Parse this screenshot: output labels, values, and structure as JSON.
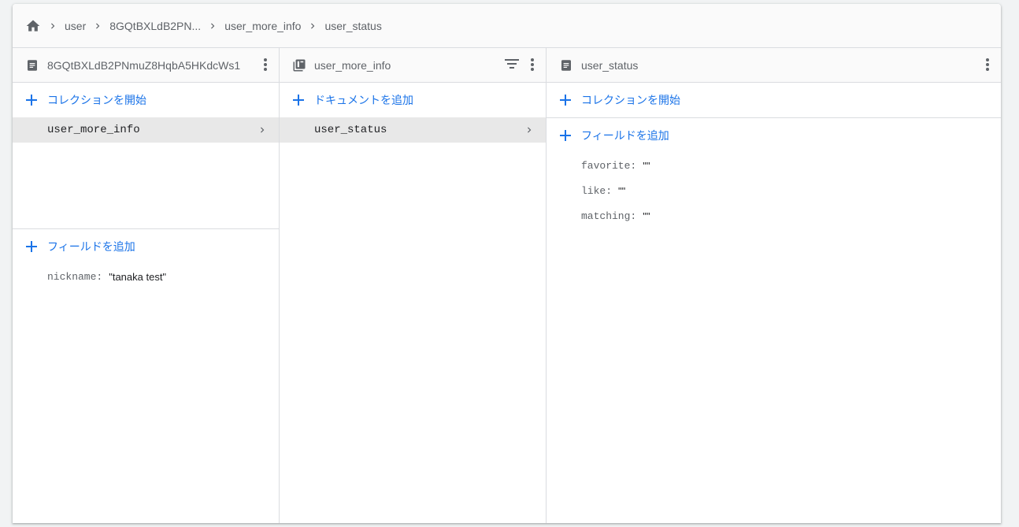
{
  "breadcrumb": {
    "home_icon": "home-icon",
    "items": [
      "user",
      "8GQtBXLdB2PN...",
      "user_more_info",
      "user_status"
    ]
  },
  "panel1": {
    "title": "8GQtBXLdB2PNmuZ8HqbA5HKdcWs1",
    "start_collection": "コレクションを開始",
    "collections": [
      "user_more_info"
    ],
    "add_field": "フィールドを追加",
    "fields": [
      {
        "key": "nickname:",
        "value": "\"tanaka test\""
      }
    ]
  },
  "panel2": {
    "title": "user_more_info",
    "add_document": "ドキュメントを追加",
    "documents": [
      "user_status"
    ]
  },
  "panel3": {
    "title": "user_status",
    "start_collection": "コレクションを開始",
    "add_field": "フィールドを追加",
    "fields": [
      {
        "key": "favorite:",
        "value": "\"\""
      },
      {
        "key": "like:",
        "value": "\"\""
      },
      {
        "key": "matching:",
        "value": "\"\""
      }
    ]
  },
  "colors": {
    "accent": "#1a73e8",
    "border": "#dadce0",
    "selected": "#e8e8e8"
  }
}
